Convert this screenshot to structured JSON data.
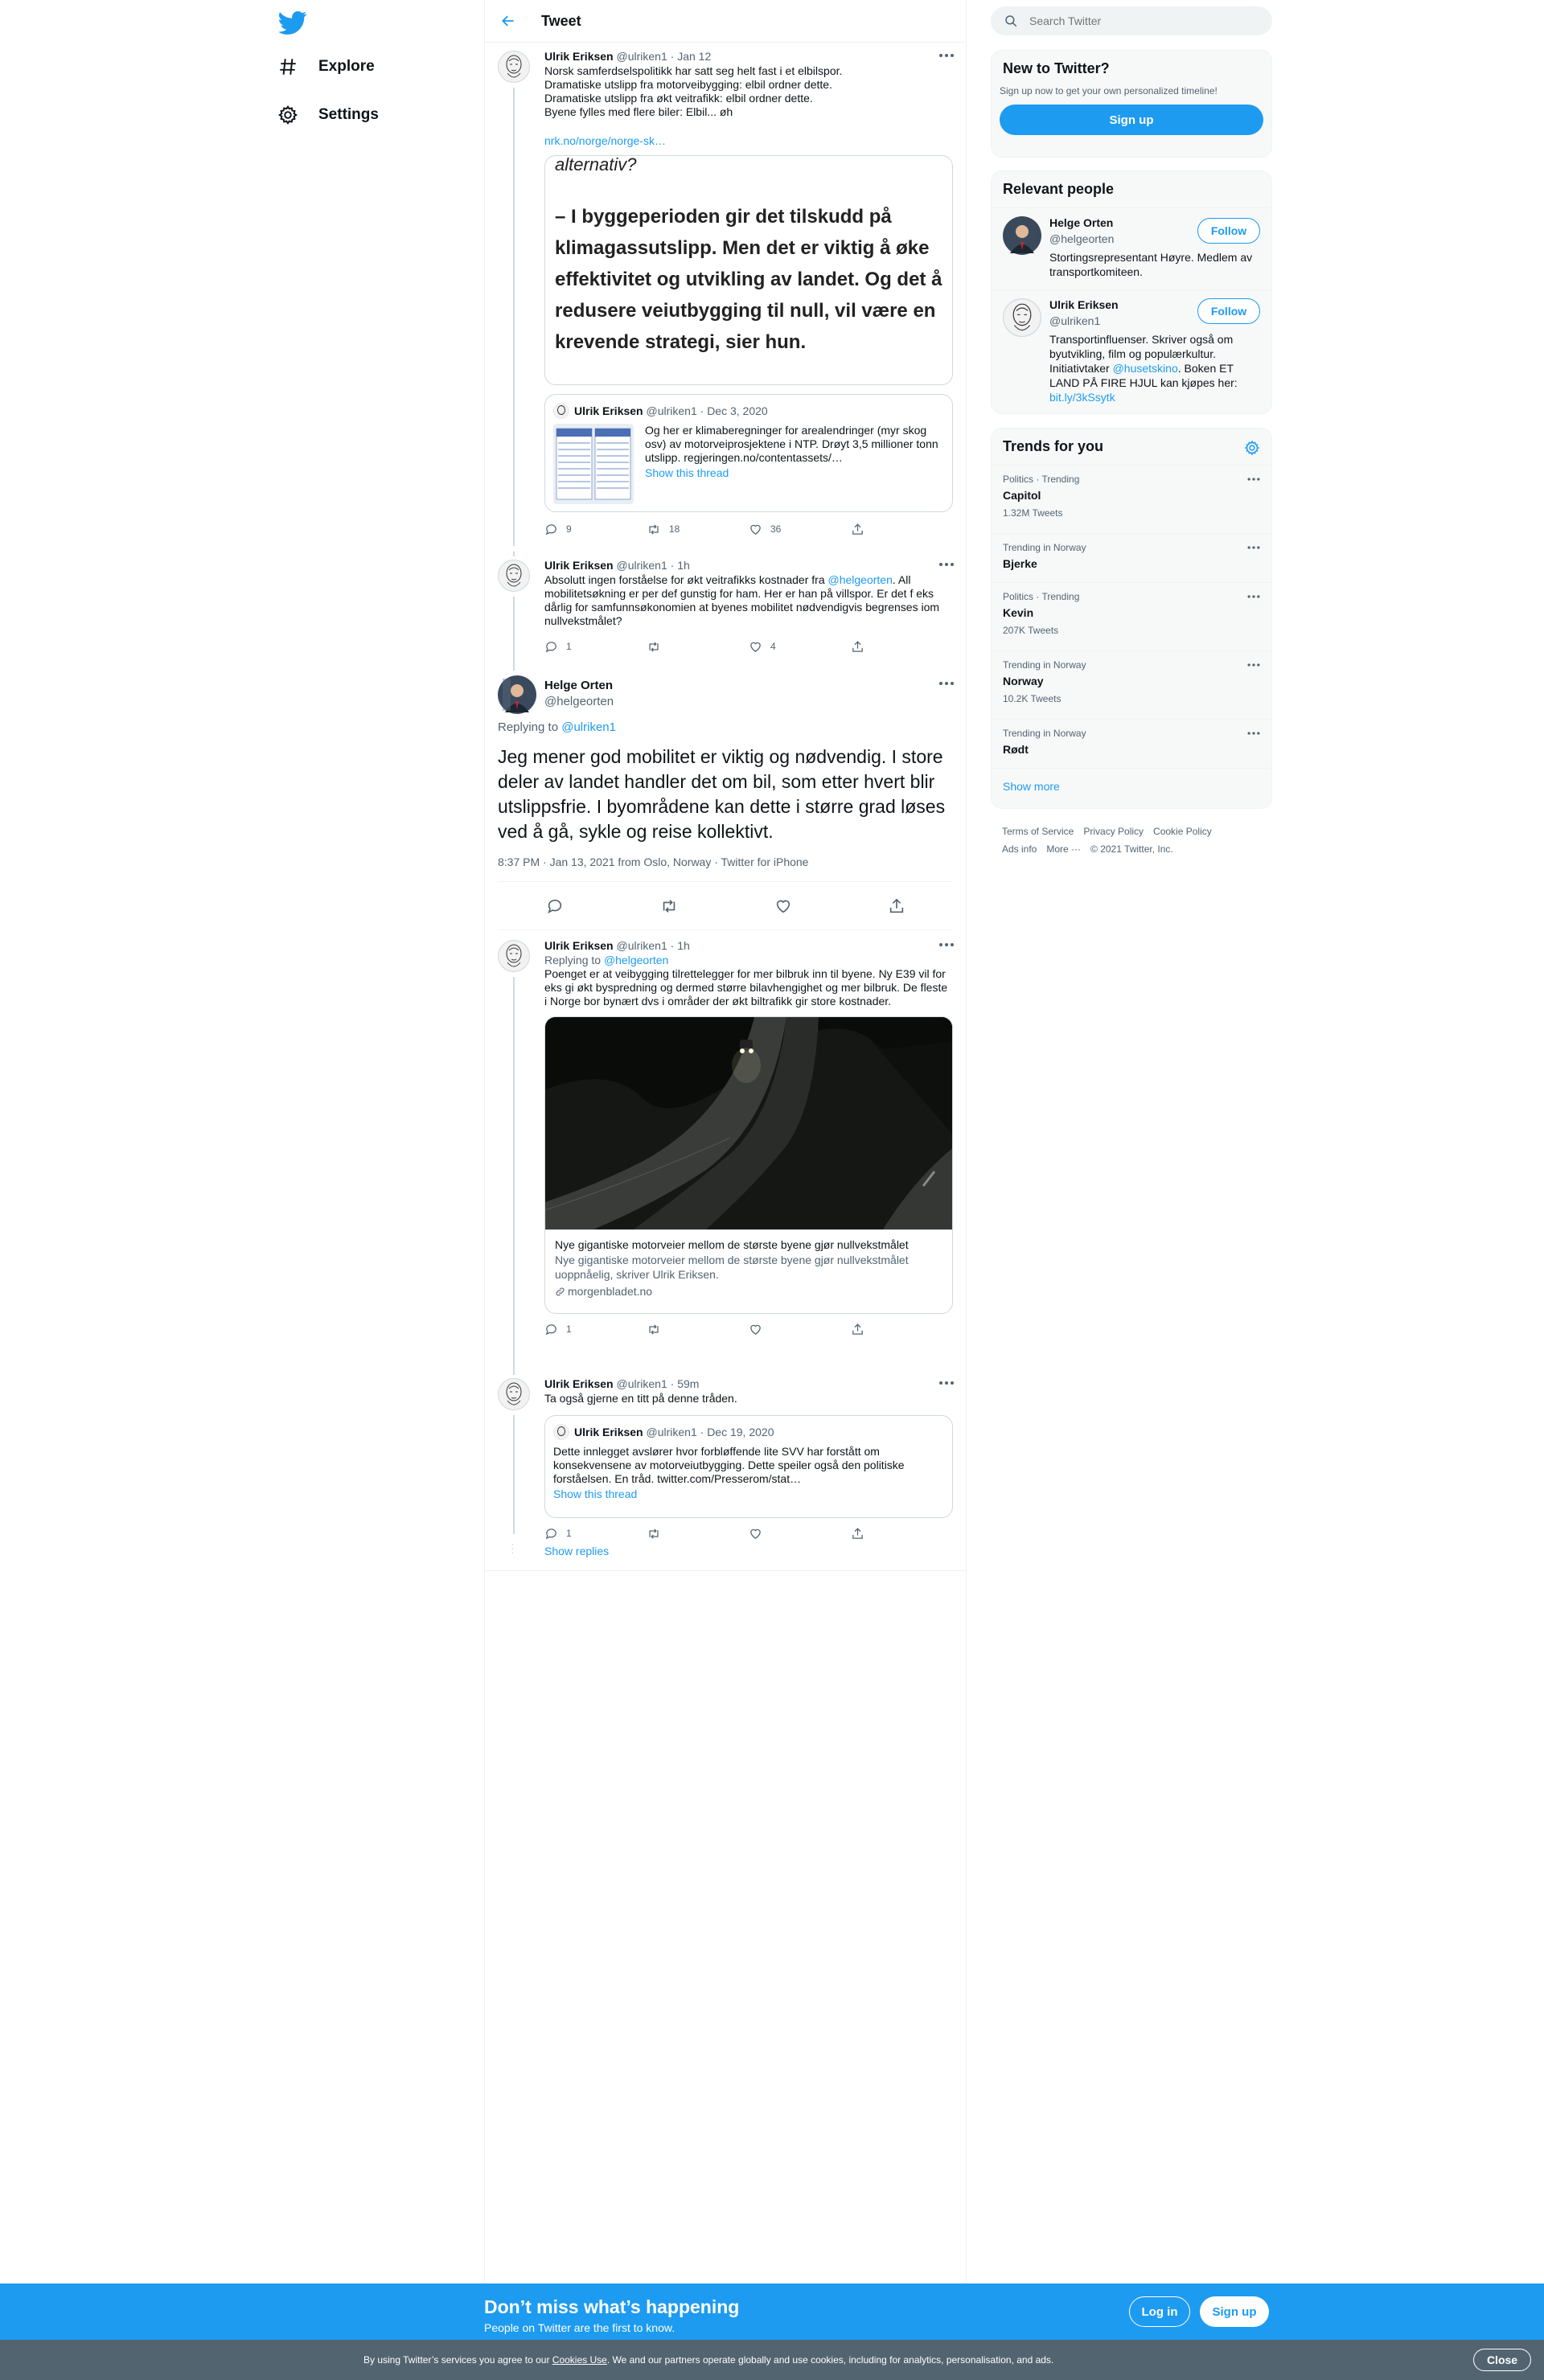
{
  "nav": {
    "explore": "Explore",
    "settings": "Settings"
  },
  "header": {
    "title": "Tweet"
  },
  "tweets": {
    "t1": {
      "name": "Ulrik Eriksen",
      "handle": "@ulriken1",
      "time": "· Jan 12",
      "lines": [
        "Norsk samferdselspolitikk har satt seg helt fast i et elbilspor.",
        "Dramatiske utslipp fra motorveibygging: elbil ordner dette.",
        "Dramatiske utslipp fra økt veitrafikk: elbil ordner dette.",
        "Byene fylles med flere biler: Elbil... øh"
      ],
      "link": "nrk.no/norge/norge-sk…",
      "image_text_top": "alternativ?",
      "image_text_main": "– I byggeperioden gir det tilskudd på klimagassutslipp. Men det er viktig å øke effektivitet og utvikling av landet. Og det å redusere veiutbygging til null, vil være en krevende strategi, sier hun.",
      "quote": {
        "name": "Ulrik Eriksen",
        "handle": "@ulriken1",
        "time": "· Dec 3, 2020",
        "text": "Og her er klimaberegninger for arealendringer (myr skog osv) av motorveiprosjektene i NTP. Drøyt 3,5 millioner tonn utslipp. regjeringen.no/contentassets/…",
        "show_thread": "Show this thread"
      },
      "replies": "9",
      "retweets": "18",
      "likes": "36"
    },
    "t2": {
      "name": "Ulrik Eriksen",
      "handle": "@ulriken1",
      "time": "· 1h",
      "text_before": "Absolutt ingen forståelse for økt veitrafikks kostnader fra ",
      "mention": "@helgeorten",
      "text_after": ". All mobilitetsøkning er per def gunstig for ham. Her er han på villspor. Er det f eks dårlig for samfunnsøkonomien at byenes mobilitet nødvendigvis begrenses iom nullvekstmålet?",
      "replies": "1",
      "retweets": "",
      "likes": "4"
    },
    "focus": {
      "name": "Helge Orten",
      "handle": "@helgeorten",
      "replying_label": "Replying to ",
      "replying_to": "@ulriken1",
      "text": "Jeg mener god mobilitet er viktig og nødvendig. I store deler av landet handler det om bil, som etter hvert blir utslippsfrie. I byområdene kan dette i større grad løses ved å gå, sykle og reise kollektivt.",
      "timestamp": "8:37 PM · Jan 13, 2021 from Oslo, Norway · Twitter for iPhone"
    },
    "t3": {
      "name": "Ulrik Eriksen",
      "handle": "@ulriken1",
      "time": "· 1h",
      "replying_label": "Replying to ",
      "replying_to": "@helgeorten",
      "text": "Poenget er at veibygging tilrettelegger for mer bilbruk inn til byene. Ny E39 vil for eks gi økt byspredning og dermed større bilavhengighet og mer bilbruk. De fleste i Norge bor bynært dvs i områder der økt biltrafikk gir store kostnader.",
      "card_title": "Nye gigantiske motorveier mellom de største byene gjør nullvekstmålet",
      "card_desc": "Nye gigantiske motorveier mellom de største byene gjør nullvekstmålet uoppnåelig, skriver Ulrik Eriksen.",
      "card_domain": "morgenbladet.no",
      "replies": "1",
      "retweets": "",
      "likes": ""
    },
    "t4": {
      "name": "Ulrik Eriksen",
      "handle": "@ulriken1",
      "time": "· 59m",
      "text": "Ta også gjerne en titt på denne tråden.",
      "quote": {
        "name": "Ulrik Eriksen",
        "handle": "@ulriken1",
        "time": "· Dec 19, 2020",
        "text": "Dette innlegget avslører hvor forbløffende lite SVV har forstått om konsekvensene av motorveiutbygging. Dette speiler også den politiske forståelsen. En tråd. twitter.com/Presserom/stat…",
        "show_thread": "Show this thread"
      },
      "replies": "1",
      "retweets": "",
      "likes": ""
    },
    "show_replies": "Show replies"
  },
  "search": {
    "placeholder": "Search Twitter"
  },
  "new_panel": {
    "title": "New to Twitter?",
    "subtitle": "Sign up now to get your own personalized timeline!",
    "signup": "Sign up"
  },
  "people": {
    "title": "Relevant people",
    "p1": {
      "name": "Helge Orten",
      "handle": "@helgeorten",
      "bio": "Stortingsrepresentant Høyre. Medlem av transportkomiteen.",
      "follow": "Follow"
    },
    "p2": {
      "name": "Ulrik Eriksen",
      "handle": "@ulriken1",
      "bio1": "Transportinfluenser. Skriver også om byutvikling, film og populærkultur. Initiativtaker ",
      "bio_mention": "@husetskino",
      "bio2": ". Boken ET LAND PÅ FIRE HJUL kan kjøpes her: ",
      "bio_link": "bit.ly/3kSsytk",
      "follow": "Follow"
    }
  },
  "trends": {
    "title": "Trends for you",
    "items": [
      {
        "context": "Politics · Trending",
        "title": "Capitol",
        "count": "1.32M Tweets"
      },
      {
        "context": "Trending in Norway",
        "title": "Bjerke",
        "count": ""
      },
      {
        "context": "Politics · Trending",
        "title": "Kevin",
        "count": "207K Tweets"
      },
      {
        "context": "Trending in Norway",
        "title": "Norway",
        "count": "10.2K Tweets"
      },
      {
        "context": "Trending in Norway",
        "title": "Rødt",
        "count": ""
      }
    ],
    "show_more": "Show more"
  },
  "footer": {
    "terms": "Terms of Service",
    "privacy": "Privacy Policy",
    "cookie": "Cookie Policy",
    "ads": "Ads info",
    "more": "More ···",
    "copyright": "© 2021 Twitter, Inc."
  },
  "banner": {
    "headline": "Don’t miss what’s happening",
    "sub": "People on Twitter are the first to know.",
    "login": "Log in",
    "signup": "Sign up"
  },
  "cookie_bar": {
    "text_before": "By using Twitter’s services you agree to our ",
    "link": "Cookies Use",
    "text_after": ". We and our partners operate globally and use cookies, including for analytics, personalisation, and ads.",
    "close": "Close"
  },
  "colors": {
    "accent": "#1d9bf0",
    "text": "#0f1419",
    "muted": "#536471",
    "border": "#eff3f4"
  },
  "icons": [
    "twitter-logo-icon",
    "hashtag-icon",
    "gear-icon",
    "back-arrow-icon",
    "search-icon",
    "more-icon",
    "reply-icon",
    "retweet-icon",
    "like-icon",
    "share-icon",
    "link-icon"
  ]
}
